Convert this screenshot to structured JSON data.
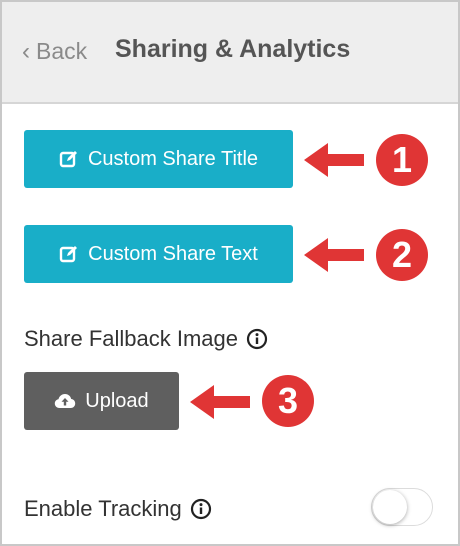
{
  "header": {
    "back_label": "Back",
    "title": "Sharing & Analytics"
  },
  "buttons": {
    "custom_share_title": "Custom Share Title",
    "custom_share_text": "Custom Share Text",
    "upload": "Upload"
  },
  "labels": {
    "share_fallback_image": "Share Fallback Image",
    "enable_tracking": "Enable Tracking"
  },
  "annotations": [
    "1",
    "2",
    "3"
  ],
  "toggle": {
    "enable_tracking": false
  },
  "icons": {
    "back": "chevron-left-icon",
    "edit": "edit-icon",
    "upload": "cloud-upload-icon",
    "info": "info-icon",
    "arrow": "arrow-left-icon"
  },
  "colors": {
    "primary_button": "#19aec8",
    "secondary_button": "#5f5f5f",
    "annotation": "#e03535",
    "header_bg": "#eeeeee"
  }
}
